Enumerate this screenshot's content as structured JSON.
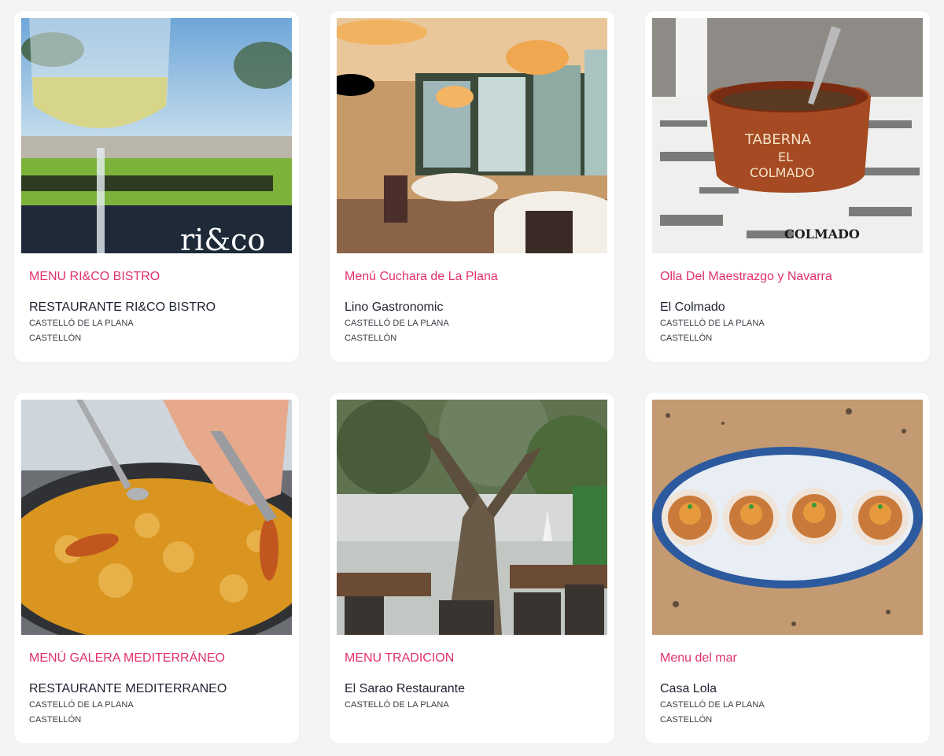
{
  "cards": [
    {
      "menu_title": "MENU RI&CO BISTRO",
      "restaurant": "RESTAURANTE RI&CO BISTRO",
      "city": "CASTELLÓ DE LA PLANA",
      "province": "CASTELLÓN",
      "photo_text": "ri&co"
    },
    {
      "menu_title": "Menú Cuchara de La Plana",
      "restaurant": "Lino Gastronomic",
      "city": "CASTELLÓ DE LA PLANA",
      "province": "CASTELLÓN"
    },
    {
      "menu_title": "Olla Del Maestrazgo y Navarra",
      "restaurant": "El Colmado",
      "city": "CASTELLÓ DE LA PLANA",
      "province": "CASTELLÓN",
      "photo_text_1": "TABERNA",
      "photo_text_2": "EL",
      "photo_text_3": "COLMADO",
      "photo_text_4": "COLMADO"
    },
    {
      "menu_title": "MENÚ GALERA MEDITERRÁNEO",
      "restaurant": "RESTAURANTE MEDITERRANEO",
      "city": "CASTELLÓ DE LA PLANA",
      "province": "CASTELLÓN"
    },
    {
      "menu_title": "MENU TRADICION",
      "restaurant": "El Sarao Restaurante",
      "city": "CASTELLÓ DE LA PLANA",
      "province": ""
    },
    {
      "menu_title": "Menu del mar",
      "restaurant": "Casa Lola",
      "city": "CASTELLÓ DE LA PLANA",
      "province": "CASTELLÓN"
    }
  ],
  "colors": {
    "accent": "#e0306e",
    "text_dark": "#1f2230",
    "page_bg": "#f4f4f4"
  }
}
